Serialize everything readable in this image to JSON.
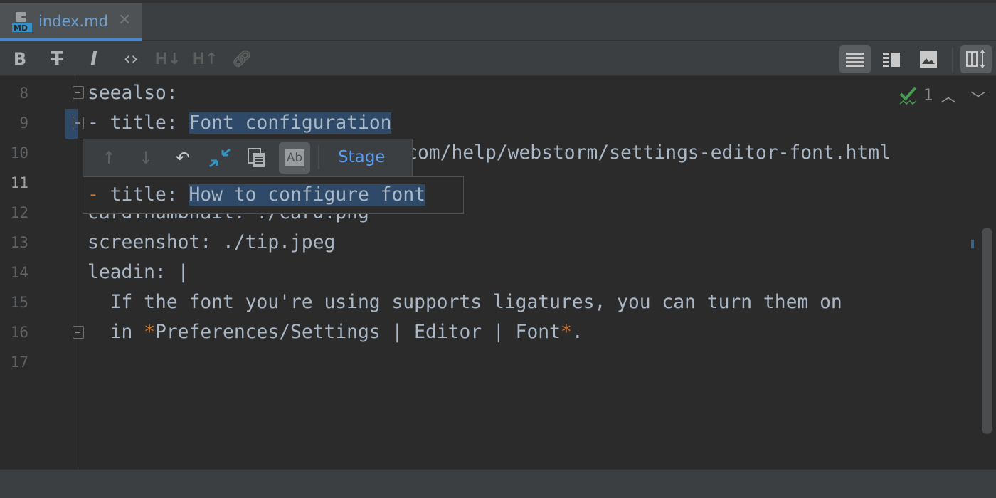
{
  "tab": {
    "filename": "index.md",
    "icon": "markdown-file-icon",
    "close_icon": "close-icon"
  },
  "toolbar": {
    "format_buttons": [
      "bold-icon",
      "strikethrough-icon",
      "italic-icon",
      "code-icon",
      "header-decrease-icon",
      "header-increase-icon",
      "link-icon"
    ],
    "view_buttons": [
      "editor-only-icon",
      "editor-and-preview-icon",
      "preview-only-icon",
      "sync-scroll-icon"
    ]
  },
  "inspections": {
    "count": "1",
    "icon": "check-icon"
  },
  "editor": {
    "current_line": 11,
    "lines": [
      {
        "n": "8",
        "text": "seealso:"
      },
      {
        "n": "9",
        "prefix": "- title: ",
        "selected": "Font configuration"
      },
      {
        "n": "10",
        "text": "  url: https://www.jetbrains.com/help/webstorm/settings-editor-font.html"
      },
      {
        "n": "11",
        "text": ""
      },
      {
        "n": "12",
        "text": "cardThumbnail: ./card.png"
      },
      {
        "n": "13",
        "text": "screenshot: ./tip.jpeg"
      },
      {
        "n": "14",
        "text": "leadin: |"
      },
      {
        "n": "15",
        "text": "  If the font you're using supports ligatures, you can turn them on"
      },
      {
        "n": "16",
        "pre": "  in ",
        "star1": "*",
        "mid": "Preferences/Settings | Editor | Font",
        "star2": "*",
        "post": "."
      },
      {
        "n": "17",
        "text": ""
      }
    ]
  },
  "diff_popup": {
    "stage_label": "Stage",
    "removed_marker": "-",
    "removed_prefix": " title: ",
    "removed_selected": "How to configure font",
    "accent": "#589df6"
  }
}
